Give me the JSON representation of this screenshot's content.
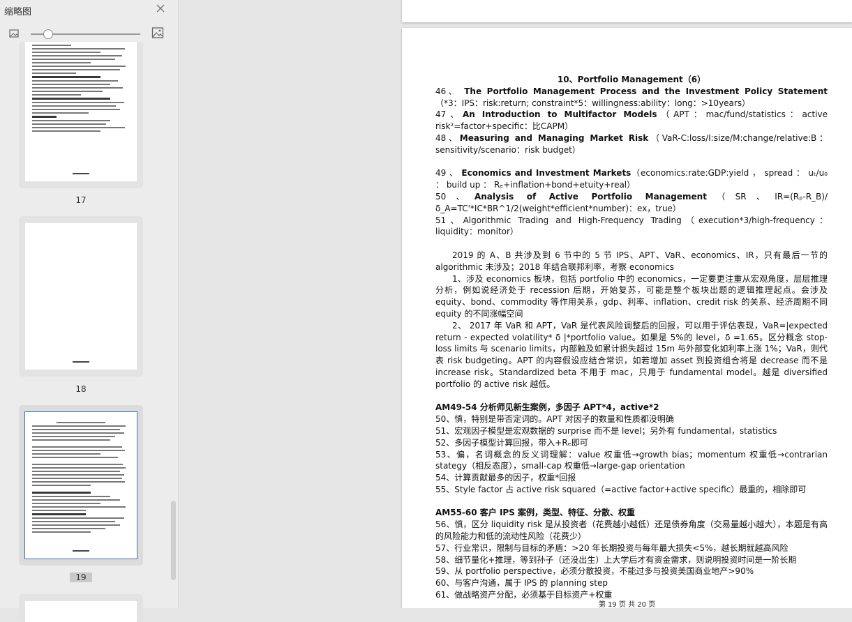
{
  "sidebar": {
    "title": "缩略图",
    "close_icon": "close-icon",
    "zoom_small_icon": "image-small-icon",
    "zoom_large_icon": "image-large-icon",
    "zoom_level": 0.15,
    "thumbnails": [
      {
        "label": "17",
        "selected": false
      },
      {
        "label": "18",
        "selected": false
      },
      {
        "label": "19",
        "selected": true
      }
    ]
  },
  "document": {
    "title": "10、Portfolio Management（6）",
    "lines": [
      {
        "id": "l46a",
        "bold": "The Portfolio Management Process and the Investment Policy Statement",
        "prefix": "46、 ",
        "rest": "（*3：IPS：risk:return; constraint*5：willingness:ability：long：>10years）"
      },
      {
        "id": "l47",
        "bold": "An Introduction to Multifactor Models",
        "prefix": "47、",
        "rest": "（APT：mac/fund/statistics：active risk²=factor+specific：比CAPM）"
      },
      {
        "id": "l48",
        "bold": "Measuring and Managing Market Risk",
        "prefix": "48、",
        "rest": "（VaR-C:loss/I:size/M:change/relative:B：sensitivity/scenario：risk budget）"
      },
      {
        "id": "l49",
        "bold": "Economics and Investment Markets",
        "prefix": "49 、 ",
        "rest": "（economics:rate:GDP:yield ， spread ： uₜ/u₀ ： build up ： Rₑ+inflation+bond+etuity+real）"
      },
      {
        "id": "l50",
        "bold": "Analysis of Active Portfolio Management",
        "prefix": "50、",
        "rest": "（SR、IR=(Rₚ-R_B)/ δ_A=TC'*IC*BR^1/2(weight*efficient*number)：ex，true）"
      },
      {
        "id": "l51",
        "bold": "",
        "prefix": "51、",
        "rest": "Algorithmic Trading and High-Frequency Trading（execution*3/high-frequency：liquidity：monitor）"
      }
    ],
    "para1": "2019 的 A、B 共涉及到 6 节中的 5 节 IPS、APT、VaR、economics、IR，只有最后一节的 algorithmic 未涉及；2018 年结合联邦利率，考察 economics",
    "para2": "1、涉及 economics 板块，包括 portfolio 中的 economics，一定要更注重从宏观角度，层层推理分析，例如说经济处于 recession 后期，开始复苏，可能是整个板块出题的逻辑推理起点。会涉及 equity、bond、commodity 等作用关系，gdp、利率、inflation、credit risk 的关系、经济周期不同 equity 的不同涨幅空间",
    "para3": "2、 2017 年 VaR 和 APT，VaR 是代表风险调整后的回报，可以用于评估表现，VaR=|expected return - expected volatility* δ |*portfolio value。如果是 5%的 level，δ =1.65。区分概念 stop-loss limits 与 scenario limits，内部触及如累计损失超过 15m 与外部变化如利率上涨 1%；VaR，则代表 risk budgeting。APT 的内容假设应结合常识，如若增加 asset 到投资组合将是 decrease 而不是 increase risk。Standardized beta 不用于 mac，只用于 fundamental model。越是 diversified portfolio 的 active risk 越低。",
    "section1_title": "AM49-54  分析师见新生案例，多因子 APT*4，active*2",
    "section1_items": [
      "50、慎，特别是带否定词的。APT 对因子的数量和性质都没明确",
      "51、宏观因子模型是宏观数据的 surprise 而不是 level；另外有 fundamental，statistics",
      "52、多因子模型计算回报，带入+Rₑ即可",
      "53、偏，名词概念的反义词理解：value 权重低→growth bias；momentum 权重低→contrarian stategy（相反态度），small-cap 权重低→large-gap orientation",
      "54、计算贡献最多的因子，权重*回报",
      "55、Style factor 占 active risk squared（=active factor+active specific）最重的，相除即可"
    ],
    "section2_title": "AM55-60  客户 IPS 案例，类型、特征、分散、权重",
    "section2_items": [
      "56、慎，区分 liquidity risk 是从投资者（花费越小越低）还是债券角度（交易量越小越大），本题是有高的风险能力和低的流动性风险（花费少）",
      "57、行业常识，限制与目标的矛盾：>20 年长期投资与每年最大损失<5%，越长期就越高风险",
      "58、细节量化+推理，等到孙子（还没出生）上大学后才有资金需求，则说明投资时间是一阶长期",
      "59、从 portfolio perspective，必须分散投资，不能过多与投资美国商业地产>90%",
      "60、与客户沟通，属于 IPS 的 planning step",
      "61、做战略资产分配，必须基于目标资产+权重"
    ],
    "footer": "第 19 页 共 20 页"
  }
}
